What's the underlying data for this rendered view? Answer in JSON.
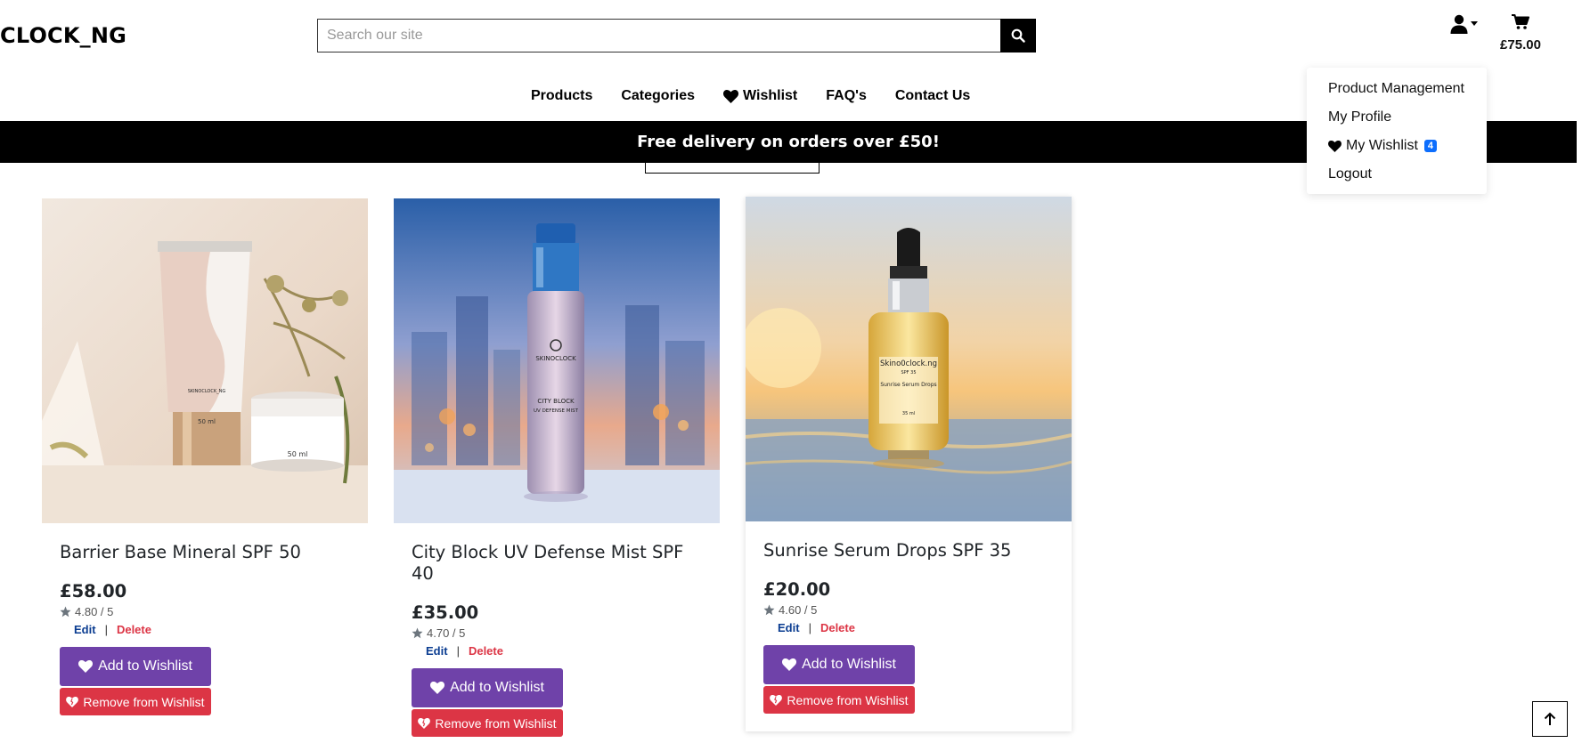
{
  "header": {
    "logo": "CLOCK_NG",
    "search_placeholder": "Search our site",
    "cart_total": "£75.00"
  },
  "nav": {
    "products": "Products",
    "categories": "Categories",
    "wishlist": "Wishlist",
    "faqs": "FAQ's",
    "contact": "Contact Us"
  },
  "banner": "Free delivery on orders over £50!",
  "account_menu": {
    "product_management": "Product Management",
    "my_profile": "My Profile",
    "my_wishlist": "My Wishlist",
    "wishlist_count": "4",
    "logout": "Logout"
  },
  "products": [
    {
      "name": "Barrier Base Mineral SPF 50",
      "price": "£58.00",
      "rating": "4.80 / 5",
      "edit": "Edit",
      "sep": "|",
      "delete": "Delete",
      "add": "Add to Wishlist",
      "remove": "Remove from Wishlist",
      "packaging_text": "SKINOCLOCK_NG",
      "size_label": "50 ml"
    },
    {
      "name": "City Block UV Defense Mist SPF 40",
      "price": "£35.00",
      "rating": "4.70 / 5",
      "edit": "Edit",
      "sep": "|",
      "delete": "Delete",
      "add": "Add to Wishlist",
      "remove": "Remove from Wishlist",
      "packaging_text": "CITY BLOCK",
      "size_label": "UV DEFENSE MIST"
    },
    {
      "name": "Sunrise Serum Drops SPF 35",
      "price": "£20.00",
      "rating": "4.60 / 5",
      "edit": "Edit",
      "sep": "|",
      "delete": "Delete",
      "add": "Add to Wishlist",
      "remove": "Remove from Wishlist",
      "packaging_text": "Skino0clock.ng",
      "size_label": "Sunrise Serum Drops"
    }
  ],
  "icons": {
    "search": "search-icon",
    "user": "user-icon",
    "cart": "cart-icon",
    "heart": "heart-icon",
    "star": "star-icon",
    "arrow_up": "arrow-up-icon"
  },
  "colors": {
    "primary_purple": "#6f42a9",
    "danger_red": "#dc3545",
    "badge_blue": "#0d6efd",
    "banner_black": "#000000"
  }
}
